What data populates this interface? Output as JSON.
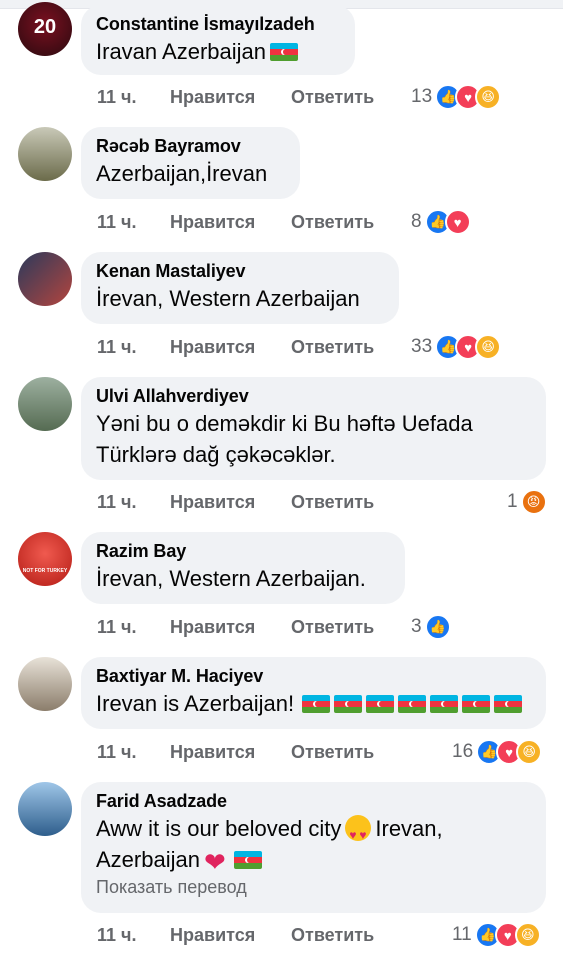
{
  "comments": [
    {
      "name": "Constantine İsmayılzadeh",
      "text": "Iravan Azerbaijan",
      "time": "11 ч.",
      "like": "Нравится",
      "reply": "Ответить",
      "count": "13",
      "reactions": [
        "like",
        "love",
        "haha"
      ],
      "flags": 1
    },
    {
      "name": "Rəcəb Bayramov",
      "text": "Azerbaijan,İrevan",
      "time": "11 ч.",
      "like": "Нравится",
      "reply": "Ответить",
      "count": "8",
      "reactions": [
        "like",
        "love"
      ]
    },
    {
      "name": "Kenan Mastaliyev",
      "text": "İrevan, Western Azerbaijan",
      "time": "11 ч.",
      "like": "Нравится",
      "reply": "Ответить",
      "count": "33",
      "reactions": [
        "like",
        "love",
        "haha"
      ]
    },
    {
      "name": "Ulvi Allahverdiyev",
      "text1": "Yəni bu o deməkdir ki Bu həftə Uefada",
      "text2": "Türklərə dağ çəkəcəklər.",
      "time": "11 ч.",
      "like": "Нравится",
      "reply": "Ответить",
      "count": "1",
      "reactions": [
        "angry"
      ]
    },
    {
      "name": "Razim Bay",
      "text": "İrevan, Western Azerbaijan.",
      "time": "11 ч.",
      "like": "Нравится",
      "reply": "Ответить",
      "count": "3",
      "reactions": [
        "like"
      ],
      "avatar_text": "NOT FOR TURKEY"
    },
    {
      "name": "Baxtiyar M. Haciyev",
      "text": "Irevan is Azerbaijan!",
      "time": "11 ч.",
      "like": "Нравится",
      "reply": "Ответить",
      "count": "16",
      "reactions": [
        "like",
        "love",
        "haha"
      ],
      "flags": 7
    },
    {
      "name": "Farid Asadzade",
      "text1": "Aww it is our beloved city",
      "text1b": "Irevan,",
      "text2": "Azerbaijan",
      "translate": "Показать перевод",
      "time": "11 ч.",
      "like": "Нравится",
      "reply": "Ответить",
      "count": "11",
      "reactions": [
        "like",
        "love",
        "haha"
      ]
    }
  ],
  "avatar0_number": "20",
  "colors": {
    "bubble": "#f0f2f5",
    "meta": "#65676b",
    "like": "#1877f2",
    "love": "#f33e58",
    "haha": "#f7b125",
    "angry": "#e9710f"
  }
}
